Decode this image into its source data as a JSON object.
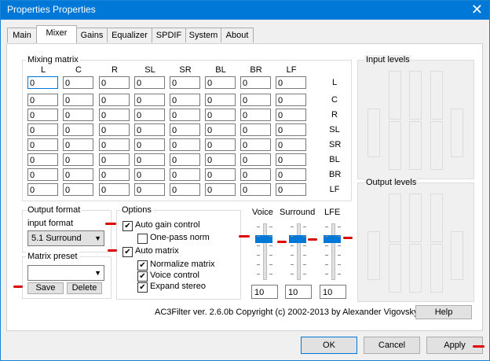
{
  "window": {
    "title": "Properties Properties",
    "close_glyph": "✕"
  },
  "tabs": [
    "Main",
    "Mixer",
    "Gains",
    "Equalizer",
    "SPDIF",
    "System",
    "About"
  ],
  "active_tab": "Mixer",
  "mixing_matrix": {
    "title": "Mixing matrix",
    "columns": [
      "L",
      "C",
      "R",
      "SL",
      "SR",
      "BL",
      "BR",
      "LF"
    ],
    "rows": [
      "L",
      "C",
      "R",
      "SL",
      "SR",
      "BL",
      "BR",
      "LF"
    ],
    "values": [
      [
        "0",
        "0",
        "0",
        "0",
        "0",
        "0",
        "0",
        "0"
      ],
      [
        "0",
        "0",
        "0",
        "0",
        "0",
        "0",
        "0",
        "0"
      ],
      [
        "0",
        "0",
        "0",
        "0",
        "0",
        "0",
        "0",
        "0"
      ],
      [
        "0",
        "0",
        "0",
        "0",
        "0",
        "0",
        "0",
        "0"
      ],
      [
        "0",
        "0",
        "0",
        "0",
        "0",
        "0",
        "0",
        "0"
      ],
      [
        "0",
        "0",
        "0",
        "0",
        "0",
        "0",
        "0",
        "0"
      ],
      [
        "0",
        "0",
        "0",
        "0",
        "0",
        "0",
        "0",
        "0"
      ],
      [
        "0",
        "0",
        "0",
        "0",
        "0",
        "0",
        "0",
        "0"
      ]
    ]
  },
  "input_levels": {
    "title": "Input levels"
  },
  "output_levels": {
    "title": "Output levels"
  },
  "output_format": {
    "title": "Output format",
    "input_format_label": "input format",
    "selected": "5.1 Surround"
  },
  "matrix_preset": {
    "title": "Matrix preset",
    "selected": "",
    "save_label": "Save",
    "delete_label": "Delete"
  },
  "options": {
    "title": "Options",
    "auto_gain_control": {
      "label": "Auto gain control",
      "checked": true
    },
    "one_pass_norm": {
      "label": "One-pass norm",
      "checked": false
    },
    "auto_matrix": {
      "label": "Auto matrix",
      "checked": true
    },
    "normalize_matrix": {
      "label": "Normalize matrix",
      "checked": true
    },
    "voice_control": {
      "label": "Voice control",
      "checked": true
    },
    "expand_stereo": {
      "label": "Expand stereo",
      "checked": true
    },
    "check_glyph": "✔"
  },
  "sliders": [
    {
      "label": "Voice",
      "value": "10"
    },
    {
      "label": "Surround",
      "value": "10"
    },
    {
      "label": "LFE",
      "value": "10"
    }
  ],
  "copyright": "AC3Filter ver. 2.6.0b Copyright (c) 2002-2013 by Alexander Vigovsky",
  "help_label": "Help",
  "footer": {
    "ok_label": "OK",
    "cancel_label": "Cancel",
    "apply_label": "Apply"
  },
  "colors": {
    "accent": "#0078d7",
    "annotation": "#dd0000"
  }
}
